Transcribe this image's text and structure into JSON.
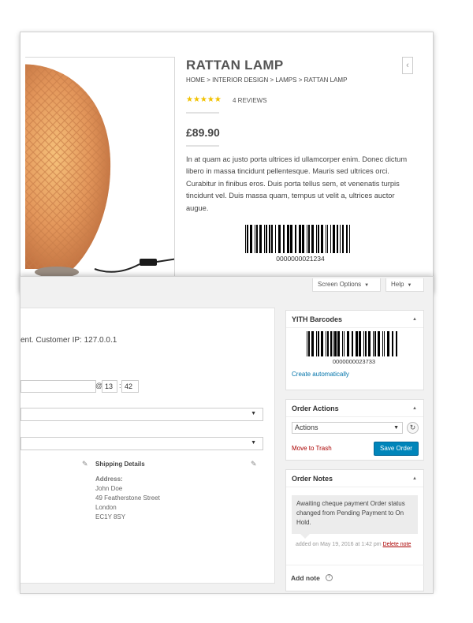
{
  "storefront": {
    "title": "RATTAN LAMP",
    "breadcrumb": "HOME > INTERIOR DESIGN > LAMPS > RATTAN LAMP",
    "rating": 5,
    "stars": "★★★★★",
    "reviews": "4 REVIEWS",
    "price": "£89.90",
    "description": "In at quam ac justo porta ultrices id ullamcorper enim. Donec dictum libero in massa tincidunt pellentesque. Mauris sed ultrices orci. Curabitur in finibus eros. Duis porta tellus sem, et venenatis turpis tincidunt vel. Duis massa quam, tempus ut velit a, ultrices auctor augue.",
    "barcode_number": "0000000021234",
    "prev_icon": "chevron-left-icon",
    "nav_glyph": "‹"
  },
  "admin": {
    "screen_options": "Screen Options",
    "help": "Help",
    "caret": "▼",
    "order": {
      "customer_ip_text": "ent. Customer IP: 127.0.0.1",
      "date_value": "",
      "at_label": "@",
      "hour": "13",
      "colon": ":",
      "minute": "42",
      "shipping_heading": "Shipping Details",
      "address_label": "Address:",
      "address_lines": [
        "John Doe",
        "49 Featherstone Street",
        "London",
        "EC1Y 8SY"
      ],
      "edit_icon": "pencil-icon",
      "pencil_glyph": "✎"
    },
    "barcodes_box": {
      "title": "YITH Barcodes",
      "barcode_number": "0000000023733",
      "create_link": "Create automatically"
    },
    "order_actions": {
      "title": "Order Actions",
      "selected_action": "Actions",
      "refresh_glyph": "↻",
      "trash_link": "Move to Trash",
      "save_button": "Save Order"
    },
    "order_notes": {
      "title": "Order Notes",
      "note_text": "Awaiting cheque payment Order status changed from Pending Payment to On Hold.",
      "note_meta": "added on May 19, 2016 at 1:42 pm",
      "delete_link": "Delete note",
      "add_note": "Add note",
      "help_glyph": "?"
    },
    "toggle_glyph": "▲",
    "colors": {
      "primary_button": "#0085ba",
      "link": "#0073aa",
      "danger": "#aa0000",
      "star": "#f2c200"
    }
  }
}
